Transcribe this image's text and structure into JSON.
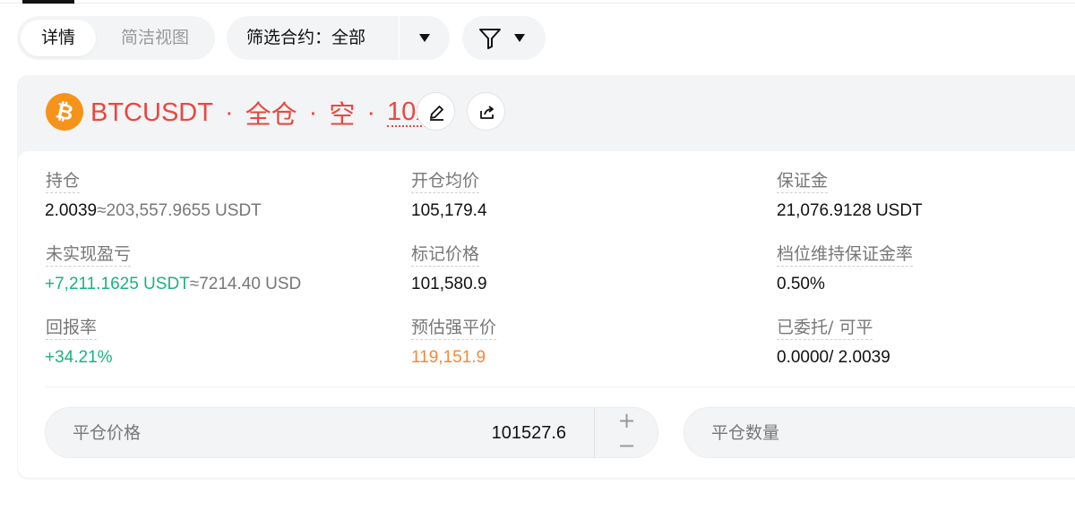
{
  "toolbar": {
    "view_tabs": [
      "详情",
      "简洁视图"
    ],
    "filter_label": "筛选合约：",
    "filter_value": "全部"
  },
  "position": {
    "symbol": "BTCUSDT",
    "margin_mode": "全仓",
    "direction": "空",
    "leverage": "10x",
    "separator": "·",
    "coin_icon": "bitcoin-icon",
    "color_short": "#e8483f",
    "color_profit": "#1bb282",
    "color_liq": "#f5883a"
  },
  "details": {
    "holding": {
      "label": "持仓",
      "size": "2.0039",
      "approx_value": "≈203,557.9655 USDT"
    },
    "entry_price": {
      "label": "开仓均价",
      "value": "105,179.4"
    },
    "margin": {
      "label": "保证金",
      "value": "21,076.9128 USDT"
    },
    "unrealized_pnl": {
      "label": "未实现盈亏",
      "value": "+7,211.1625 USDT",
      "approx_usd": "≈7214.40 USD"
    },
    "mark_price": {
      "label": "标记价格",
      "value": "101,580.9"
    },
    "maintenance_rate": {
      "label": "档位维持保证金率",
      "value": "0.50%"
    },
    "roe": {
      "label": "回报率",
      "value": "+34.21%"
    },
    "liq_price": {
      "label": "预估强平价",
      "value": "119,151.9"
    },
    "closable": {
      "label": "已委托/ 可平",
      "value": "0.0000/ 2.0039"
    }
  },
  "close_form": {
    "price_label": "平仓价格",
    "price_value": "101527.6",
    "plus": "+",
    "minus": "−",
    "qty_label": "平仓数量"
  }
}
